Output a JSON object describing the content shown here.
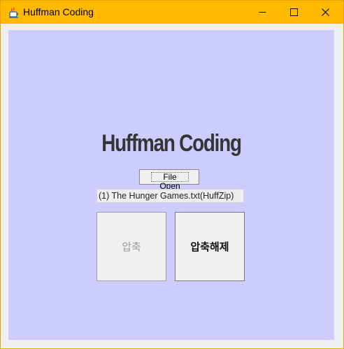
{
  "window": {
    "title": "Huffman Coding",
    "icon": "java-cup-icon",
    "controls": {
      "minimize": "minimize-icon",
      "maximize": "maximize-icon",
      "close": "close-icon"
    }
  },
  "main": {
    "heading": "Huffman Coding",
    "file_open_label": "File Open",
    "file_name": "(1) The Hunger Games.txt(HuffZip)",
    "compress_label": "압축",
    "decompress_label": "압축해제"
  },
  "colors": {
    "titlebar": "#ffba00",
    "content_background": "#ccccff",
    "button_face": "#f0f0f0",
    "disabled_text": "#999999"
  }
}
